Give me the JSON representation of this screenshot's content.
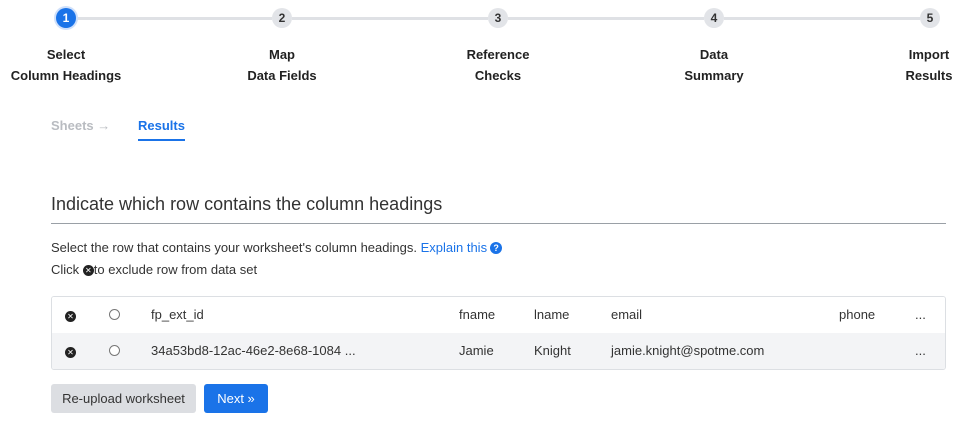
{
  "stepper": {
    "steps": [
      {
        "number": "1",
        "line1": "Select",
        "line2": "Column Headings",
        "active": true
      },
      {
        "number": "2",
        "line1": "Map",
        "line2": "Data Fields",
        "active": false
      },
      {
        "number": "3",
        "line1": "Reference",
        "line2": "Checks",
        "active": false
      },
      {
        "number": "4",
        "line1": "Data",
        "line2": "Summary",
        "active": false
      },
      {
        "number": "5",
        "line1": "Import",
        "line2": "Results",
        "active": false
      }
    ]
  },
  "tabs": {
    "sheets": "Sheets →",
    "results": "Results"
  },
  "section": {
    "title": "Indicate which row contains the column headings",
    "instruction": "Select the row that contains your worksheet's column headings.",
    "explain_link": "Explain this",
    "help_icon": "?",
    "exclude_prefix": "Click",
    "exclude_suffix": "to exclude row from data set",
    "exclude_icon": "✕"
  },
  "table": {
    "rows": [
      {
        "fp_ext_id": "fp_ext_id",
        "fname": "fname",
        "lname": "lname",
        "email": "email",
        "phone": "phone",
        "more": "..."
      },
      {
        "fp_ext_id": "34a53bd8-12ac-46e2-8e68-1084 ...",
        "fname": "Jamie",
        "lname": "Knight",
        "email": "jamie.knight@spotme.com",
        "phone": "",
        "more": "..."
      }
    ]
  },
  "buttons": {
    "reupload": "Re-upload worksheet",
    "next": "Next »"
  },
  "colors": {
    "accent": "#1a73e8",
    "step_inactive": "#e2e4e8",
    "row_alt": "#f3f4f6"
  }
}
